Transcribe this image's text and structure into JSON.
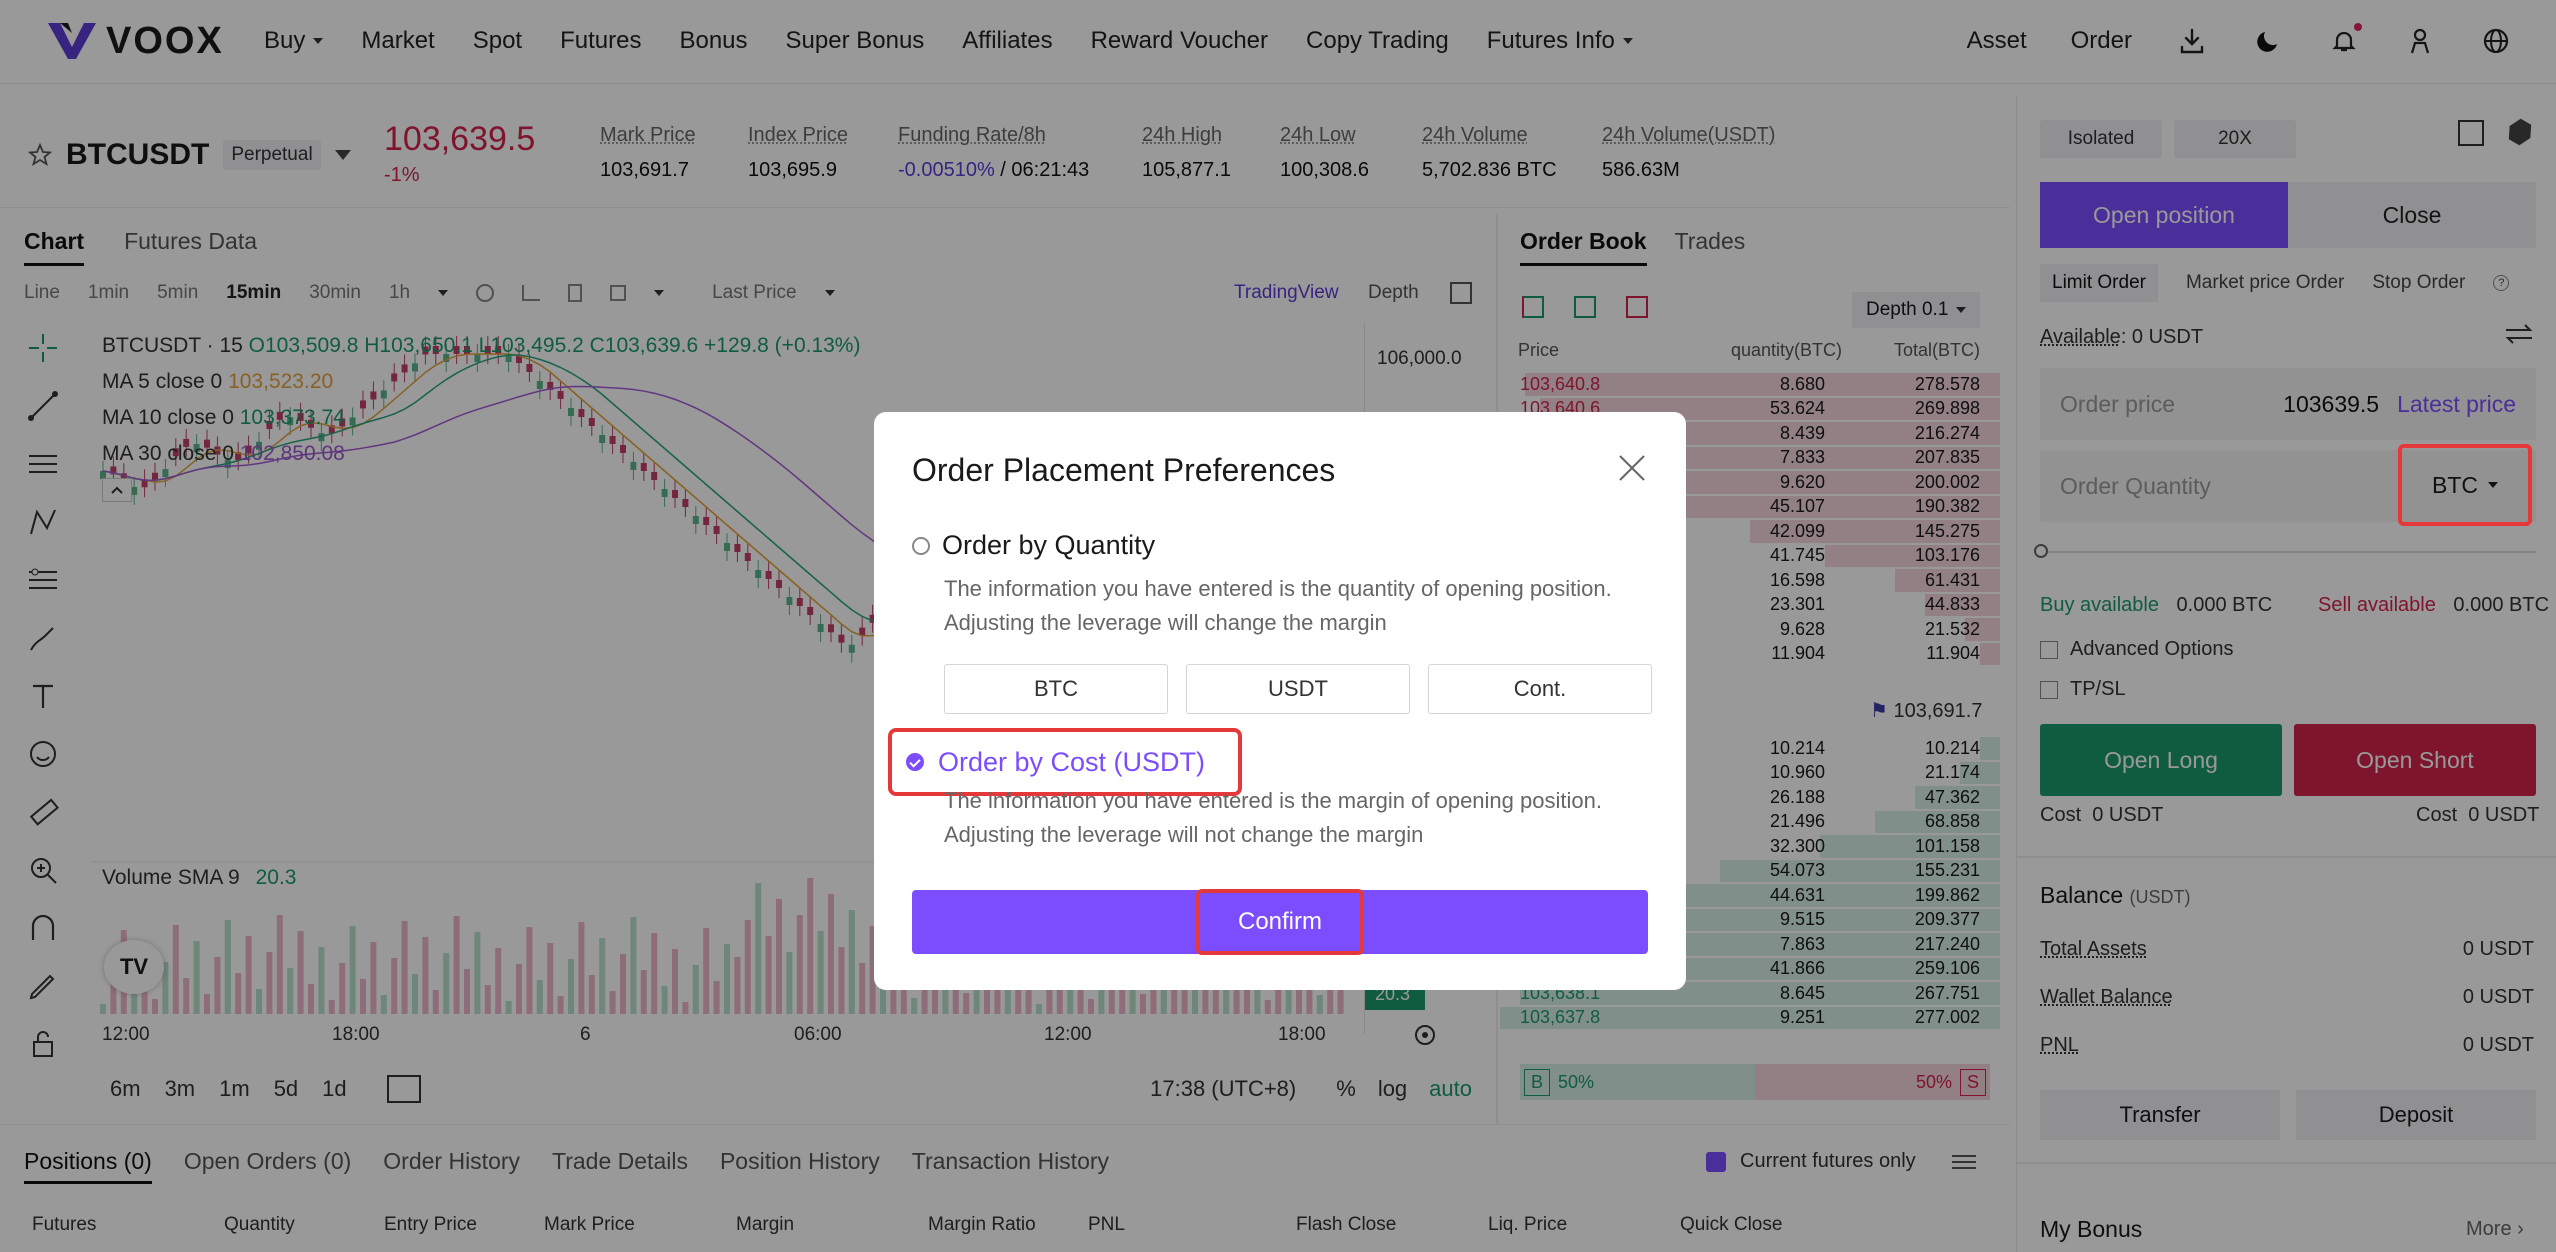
{
  "header": {
    "logo_text": "VOOX",
    "nav": [
      {
        "label": "Buy",
        "dropdown": true
      },
      {
        "label": "Market"
      },
      {
        "label": "Spot"
      },
      {
        "label": "Futures"
      },
      {
        "label": "Bonus"
      },
      {
        "label": "Super Bonus"
      },
      {
        "label": "Affiliates"
      },
      {
        "label": "Reward Voucher"
      },
      {
        "label": "Copy Trading"
      },
      {
        "label": "Futures Info",
        "dropdown": true
      }
    ],
    "asset": "Asset",
    "order": "Order"
  },
  "ticker": {
    "symbol": "BTCUSDT",
    "contract_type": "Perpetual",
    "last_price": "103,639.5",
    "change": "-1%",
    "stats": [
      {
        "label": "Mark Price",
        "value": "103,691.7"
      },
      {
        "label": "Index Price",
        "value": "103,695.9"
      },
      {
        "label": "Funding Rate/8h",
        "value_rate": "-0.00510%",
        "value_time": " / 06:21:43"
      },
      {
        "label": "24h High",
        "value": "105,877.1"
      },
      {
        "label": "24h Low",
        "value": "100,308.6"
      },
      {
        "label": "24h Volume",
        "value": "5,702.836 BTC"
      },
      {
        "label": "24h Volume(USDT)",
        "value": "586.63M"
      }
    ]
  },
  "chart": {
    "tabs": [
      "Chart",
      "Futures Data"
    ],
    "timeframes": [
      "Line",
      "1min",
      "5min",
      "15min",
      "30min",
      "1h"
    ],
    "selected_timeframe": "15min",
    "last_price_toggle": "Last Price",
    "tradingview": "TradingView",
    "depth": "Depth",
    "legend_title": "BTCUSDT · 15",
    "ohlc": "O103,509.8  H103,650.1  L103,495.2  C103,639.6  +129.8 (+0.13%)",
    "ma5": {
      "label": "MA 5 close 0",
      "value": "103,523.20"
    },
    "ma10": {
      "label": "MA 10 close 0",
      "value": "103,373.74"
    },
    "ma30": {
      "label": "MA 30 close 0",
      "value": "102,850.08"
    },
    "volume_label": "Volume SMA 9",
    "volume_value": "20.3",
    "price_axis_top": "106,000.0",
    "volume_axis": "20.3",
    "x_labels": [
      "12:00",
      "18:00",
      "6",
      "06:00",
      "12:00",
      "18:00"
    ],
    "ranges": [
      "6m",
      "3m",
      "1m",
      "5d",
      "1d"
    ],
    "clock": "17:38 (UTC+8)",
    "pct": "%",
    "log": "log",
    "auto": "auto"
  },
  "orderbook": {
    "tabs": [
      "Order Book",
      "Trades"
    ],
    "depth_select": "Depth 0.1",
    "headers": {
      "price": "Price",
      "qty": "quantity(BTC)",
      "total": "Total(BTC)"
    },
    "asks": [
      {
        "price": "103,640.8",
        "qty": "8.680",
        "total": "278.578",
        "fill": 0.95
      },
      {
        "price": "103,640.6",
        "qty": "53.624",
        "total": "269.898",
        "fill": 0.92
      },
      {
        "price": "",
        "qty": "8.439",
        "total": "216.274",
        "fill": 0.74
      },
      {
        "price": "",
        "qty": "7.833",
        "total": "207.835",
        "fill": 0.71
      },
      {
        "price": "",
        "qty": "9.620",
        "total": "200.002",
        "fill": 0.68
      },
      {
        "price": "",
        "qty": "45.107",
        "total": "190.382",
        "fill": 0.65
      },
      {
        "price": "",
        "qty": "42.099",
        "total": "145.275",
        "fill": 0.5
      },
      {
        "price": "",
        "qty": "41.745",
        "total": "103.176",
        "fill": 0.35
      },
      {
        "price": "",
        "qty": "16.598",
        "total": "61.431",
        "fill": 0.21
      },
      {
        "price": "",
        "qty": "23.301",
        "total": "44.833",
        "fill": 0.15
      },
      {
        "price": "",
        "qty": "9.628",
        "total": "21.532",
        "fill": 0.07
      },
      {
        "price": "",
        "qty": "11.904",
        "total": "11.904",
        "fill": 0.04
      }
    ],
    "mid_price": "103,691.7",
    "bids": [
      {
        "price": "",
        "qty": "10.214",
        "total": "10.214",
        "fill": 0.04
      },
      {
        "price": "",
        "qty": "10.960",
        "total": "21.174",
        "fill": 0.08
      },
      {
        "price": "",
        "qty": "26.188",
        "total": "47.362",
        "fill": 0.17
      },
      {
        "price": "",
        "qty": "21.496",
        "total": "68.858",
        "fill": 0.25
      },
      {
        "price": "",
        "qty": "32.300",
        "total": "101.158",
        "fill": 0.36
      },
      {
        "price": "",
        "qty": "54.073",
        "total": "155.231",
        "fill": 0.56
      },
      {
        "price": "",
        "qty": "44.631",
        "total": "199.862",
        "fill": 0.72
      },
      {
        "price": "",
        "qty": "9.515",
        "total": "209.377",
        "fill": 0.75
      },
      {
        "price": "",
        "qty": "7.863",
        "total": "217.240",
        "fill": 0.78
      },
      {
        "price": "",
        "qty": "41.866",
        "total": "259.106",
        "fill": 0.93
      },
      {
        "price": "103,638.1",
        "qty": "8.645",
        "total": "267.751",
        "fill": 0.96
      },
      {
        "price": "103,637.8",
        "qty": "9.251",
        "total": "277.002",
        "fill": 1.0
      }
    ],
    "ratio_buy_label": "B",
    "ratio_buy": "50%",
    "ratio_sell": "50%",
    "ratio_sell_label": "S"
  },
  "trade_panel": {
    "margin_mode": "Isolated",
    "leverage": "20X",
    "open_tab": "Open position",
    "close_tab": "Close",
    "order_types": [
      "Limit Order",
      "Market price Order",
      "Stop Order"
    ],
    "available_label": "Available",
    "available_value": ": 0 USDT",
    "order_price_placeholder": "Order price",
    "order_price_value": "103639.5",
    "latest_price": "Latest price",
    "order_qty_placeholder": "Order Quantity",
    "qty_unit": "BTC",
    "buy_available_label": "Buy available",
    "buy_available_value": "0.000 BTC",
    "sell_available_label": "Sell available",
    "sell_available_value": "0.000 BTC",
    "advanced_options": "Advanced Options",
    "tpsl": "TP/SL",
    "open_long": "Open Long",
    "open_short": "Open Short",
    "cost_label": "Cost",
    "cost_long": "0 USDT",
    "cost_short": "0 USDT",
    "balance_title": "Balance",
    "balance_unit": "(USDT)",
    "balance_rows": [
      {
        "label": "Total Assets",
        "value": "0 USDT"
      },
      {
        "label": "Wallet Balance",
        "value": "0 USDT"
      },
      {
        "label": "PNL",
        "value": "0 USDT"
      }
    ],
    "transfer": "Transfer",
    "deposit": "Deposit",
    "my_bonus": "My Bonus",
    "more": "More"
  },
  "positions": {
    "tabs": [
      "Positions (0)",
      "Open Orders (0)",
      "Order History",
      "Trade Details",
      "Position History",
      "Transaction History"
    ],
    "current_only": "Current futures only",
    "columns": [
      "Futures",
      "Quantity",
      "Entry Price",
      "Mark Price",
      "Margin",
      "Margin Ratio",
      "PNL",
      "Flash Close",
      "Liq. Price",
      "Quick Close"
    ]
  },
  "modal": {
    "title": "Order Placement Preferences",
    "option_quantity": "Order by Quantity",
    "option_quantity_desc": "The information you have entered is the quantity of opening position. Adjusting the leverage will change the margin",
    "units": [
      "BTC",
      "USDT",
      "Cont."
    ],
    "option_cost": "Order by Cost (USDT)",
    "option_cost_desc": "The information you have entered is the margin of opening position. Adjusting the leverage will not change the margin",
    "confirm": "Confirm",
    "selected": "cost"
  },
  "colors": {
    "accent": "#7c4dff",
    "up": "#1c9a6c",
    "down": "#d2244a",
    "highlight": "#e5383b"
  }
}
